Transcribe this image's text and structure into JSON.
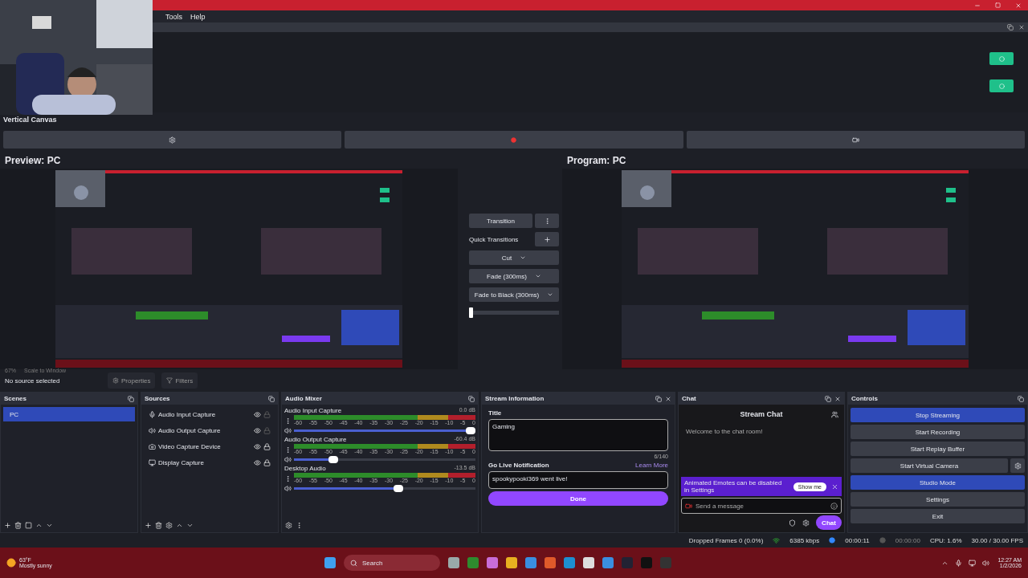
{
  "webcam": {
    "kind": "picture"
  },
  "menu": [
    "Tools",
    "Help"
  ],
  "vertical_canvas": {
    "title": "Vertical Canvas"
  },
  "preview": {
    "title": "Preview: PC",
    "zoom": "67%",
    "scale": "Scale to Window"
  },
  "program": {
    "title": "Program: PC"
  },
  "transitions": {
    "transition": "Transition",
    "quick": "Quick Transitions",
    "options": [
      "Cut",
      "Fade (300ms)",
      "Fade to Black (300ms)"
    ],
    "level": 0
  },
  "source_bar": {
    "status": "No source selected",
    "properties": "Properties",
    "filters": "Filters"
  },
  "scenes": {
    "title": "Scenes",
    "items": [
      {
        "name": "PC",
        "selected": true
      }
    ]
  },
  "sources": {
    "title": "Sources",
    "items": [
      {
        "name": "Audio Input Capture",
        "kind": "mic",
        "visible": true,
        "locked": false
      },
      {
        "name": "Audio Output Capture",
        "kind": "speaker",
        "visible": true,
        "locked": false
      },
      {
        "name": "Video Capture Device",
        "kind": "camera",
        "visible": true,
        "locked": true
      },
      {
        "name": "Display Capture",
        "kind": "display",
        "visible": true,
        "locked": true
      }
    ]
  },
  "mixer": {
    "title": "Audio Mixer",
    "channels": [
      {
        "name": "Audio Input Capture",
        "reading": "0.0 dB",
        "level": 1,
        "scale": [
          "-60",
          "-55",
          "-50",
          "-45",
          "-40",
          "-35",
          "-30",
          "-25",
          "-20",
          "-15",
          "-10",
          "-5",
          "0"
        ]
      },
      {
        "name": "Audio Output Capture",
        "reading": "-60.4 dB",
        "level": 0.2,
        "scale": [
          "-60",
          "-55",
          "-50",
          "-45",
          "-40",
          "-35",
          "-30",
          "-25",
          "-20",
          "-15",
          "-10",
          "-5",
          "0"
        ]
      },
      {
        "name": "Desktop Audio",
        "reading": "-13.5 dB",
        "level": 0.58,
        "scale": [
          "-60",
          "-55",
          "-50",
          "-45",
          "-40",
          "-35",
          "-30",
          "-25",
          "-20",
          "-15",
          "-10",
          "-5",
          "0"
        ]
      }
    ]
  },
  "stream_info": {
    "title": "Stream Information",
    "title_label": "Title",
    "title_value": "Gaming",
    "count": "6/140",
    "notification_label": "Go Live Notification",
    "learn_more": "Learn More",
    "notification_value": "spookypooki369 went live!",
    "done": "Done"
  },
  "chat": {
    "title": "Chat",
    "header": "Stream Chat",
    "welcome": "Welcome to the chat room!",
    "banner": "Animated Emotes can be disabled in Settings",
    "show_me": "Show me",
    "placeholder": "Send a message",
    "send": "Chat"
  },
  "controls": {
    "title": "Controls",
    "buttons": [
      {
        "label": "Stop Streaming",
        "selected": true
      },
      {
        "label": "Start Recording",
        "selected": false
      },
      {
        "label": "Start Replay Buffer",
        "selected": false
      },
      {
        "label": "Start Virtual Camera",
        "selected": false
      },
      {
        "label": "Studio Mode",
        "selected": true
      },
      {
        "label": "Settings",
        "selected": false
      },
      {
        "label": "Exit",
        "selected": false
      }
    ]
  },
  "status_bar": {
    "dropped": "Dropped Frames 0 (0.0%)",
    "bitrate": "6385 kbps",
    "stream_time": "00:00:11",
    "record_time": "00:00:00",
    "cpu": "CPU: 1.6%",
    "fps": "30.00 / 30.00 FPS"
  },
  "taskbar": {
    "temperature": "63°F",
    "weather": "Mostly sunny",
    "search": "Search",
    "time": "12:27 AM",
    "date": "1/2/2026"
  }
}
